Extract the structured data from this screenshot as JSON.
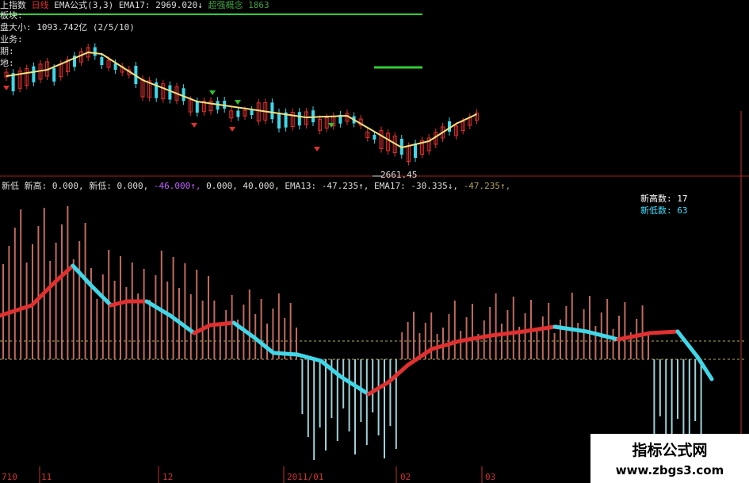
{
  "header": {
    "t1": "上指数",
    "t2": "日线",
    "t3": "EMA公式(3,3)",
    "t4": "EMA17:",
    "t5": "2969.020↓",
    "t6": "超强概念",
    "t7": "1863"
  },
  "info_lines": [
    "板块:",
    "盘大小: 1093.742亿 (2/5/10)",
    "业务:",
    "期:",
    "地:"
  ],
  "low_label": "2661.45",
  "indicator_line": [
    {
      "text": "新低",
      "color": "#dddddd"
    },
    {
      "text": " 新高: 0.000,",
      "color": "#dddddd"
    },
    {
      "text": " 新低: 0.000,",
      "color": "#dddddd"
    },
    {
      "text": " -46.000↑,",
      "color": "#c060ff"
    },
    {
      "text": " 0.000, 40.000,",
      "color": "#dddddd"
    },
    {
      "text": " EMA13: -47.235↑,",
      "color": "#dddddd"
    },
    {
      "text": " EMA17: -30.335↓,",
      "color": "#dddddd"
    },
    {
      "text": " -47.235↑,",
      "color": "#b0a060"
    }
  ],
  "counts": [
    {
      "label": "新高数: 17",
      "color": "#ffffff"
    },
    {
      "label": "新低数: 63",
      "color": "#40e0ff"
    }
  ],
  "date_labels": [
    "710",
    "11",
    "12",
    "2011/01",
    "02",
    "03"
  ],
  "watermark": {
    "cn": "指标公式网",
    "url": "www.zbgs3.com"
  },
  "colors": {
    "up": "#e03030",
    "down": "#40d8e8",
    "ema": "#f0e080",
    "up_bar": "#c06a60",
    "down_bar": "#9fd0d8"
  },
  "chart_data": [
    {
      "type": "candlestick",
      "title": "上指数 日线",
      "ema_name": "EMA17",
      "ema_value": 2969.02,
      "low_marker": 2661.45,
      "candles": [
        [
          0,
          1
        ],
        [
          1,
          -1
        ],
        [
          2,
          1
        ],
        [
          3,
          1
        ],
        [
          4,
          -1
        ],
        [
          5,
          1
        ],
        [
          6,
          1
        ],
        [
          7,
          -1
        ],
        [
          8,
          1
        ],
        [
          9,
          1
        ],
        [
          10,
          -1
        ],
        [
          11,
          1
        ],
        [
          12,
          1
        ],
        [
          13,
          -1
        ],
        [
          14,
          -1
        ],
        [
          15,
          1
        ],
        [
          16,
          -1
        ],
        [
          17,
          1
        ],
        [
          18,
          1
        ],
        [
          19,
          -1
        ],
        [
          20,
          1
        ],
        [
          21,
          1
        ],
        [
          22,
          -1
        ],
        [
          23,
          1
        ],
        [
          24,
          -1
        ],
        [
          25,
          1
        ],
        [
          26,
          -1
        ],
        [
          27,
          1
        ],
        [
          28,
          -1
        ],
        [
          29,
          1
        ],
        [
          30,
          1
        ],
        [
          31,
          -1
        ],
        [
          32,
          -1
        ],
        [
          33,
          1
        ],
        [
          34,
          -1
        ],
        [
          35,
          1
        ],
        [
          36,
          -1
        ],
        [
          37,
          1
        ],
        [
          38,
          1
        ],
        [
          39,
          -1
        ],
        [
          40,
          -1
        ],
        [
          41,
          -1
        ],
        [
          42,
          1
        ],
        [
          43,
          -1
        ],
        [
          44,
          1
        ],
        [
          45,
          -1
        ],
        [
          46,
          1
        ],
        [
          47,
          1
        ],
        [
          48,
          1
        ],
        [
          49,
          -1
        ],
        [
          50,
          1
        ],
        [
          51,
          -1
        ],
        [
          52,
          1
        ],
        [
          53,
          1
        ],
        [
          54,
          -1
        ],
        [
          55,
          1
        ],
        [
          56,
          1
        ],
        [
          57,
          1
        ],
        [
          58,
          -1
        ],
        [
          59,
          1
        ],
        [
          60,
          -1
        ],
        [
          61,
          1
        ],
        [
          62,
          1
        ],
        [
          63,
          1
        ],
        [
          64,
          1
        ],
        [
          65,
          -1
        ],
        [
          66,
          1
        ],
        [
          67,
          1
        ],
        [
          68,
          1
        ],
        [
          69,
          1
        ]
      ]
    },
    {
      "type": "bar",
      "title": "新高/新低",
      "new_high_count": 17,
      "new_low_count": 63,
      "ema13": -47.235,
      "ema17": -30.335
    }
  ]
}
